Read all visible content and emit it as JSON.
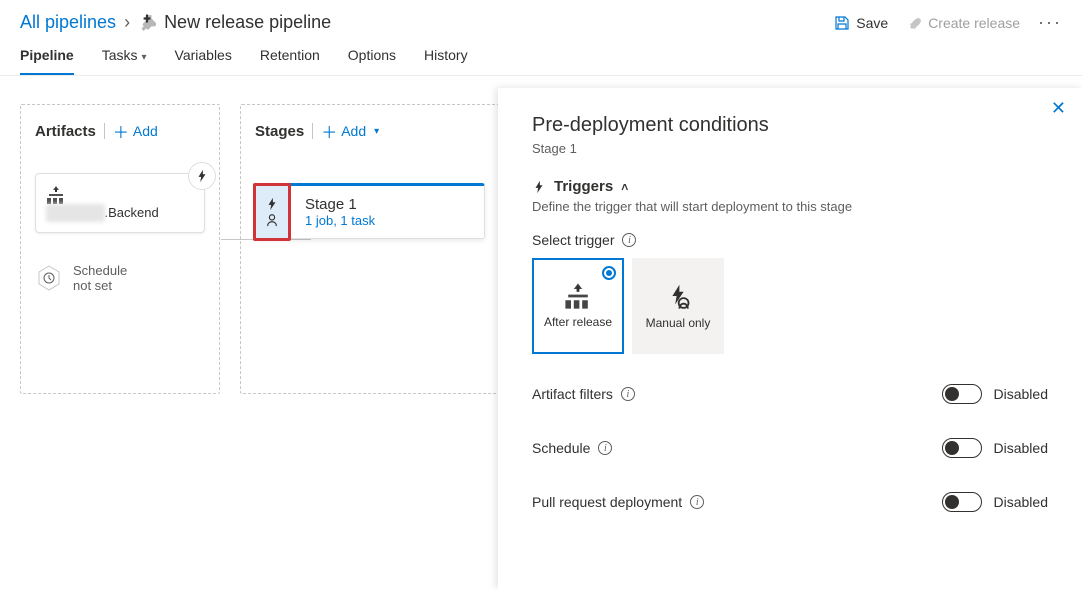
{
  "breadcrumb": {
    "root": "All pipelines",
    "current": "New release pipeline"
  },
  "header_actions": {
    "save": "Save",
    "create_release": "Create release"
  },
  "tabs": [
    "Pipeline",
    "Tasks",
    "Variables",
    "Retention",
    "Options",
    "History"
  ],
  "artifacts": {
    "title": "Artifacts",
    "add": "Add",
    "card_suffix": ".Backend",
    "schedule_label": "Schedule not set"
  },
  "stages": {
    "title": "Stages",
    "add": "Add",
    "stage_name": "Stage 1",
    "stage_sub": "1 job, 1 task"
  },
  "panel": {
    "title": "Pre-deployment conditions",
    "subtitle": "Stage 1",
    "triggers_head": "Triggers",
    "triggers_desc": "Define the trigger that will start deployment to this stage",
    "select_trigger": "Select trigger",
    "option_after": "After release",
    "option_manual": "Manual only",
    "artifact_filters": "Artifact filters",
    "schedule": "Schedule",
    "pr_deploy": "Pull request deployment",
    "disabled": "Disabled"
  }
}
